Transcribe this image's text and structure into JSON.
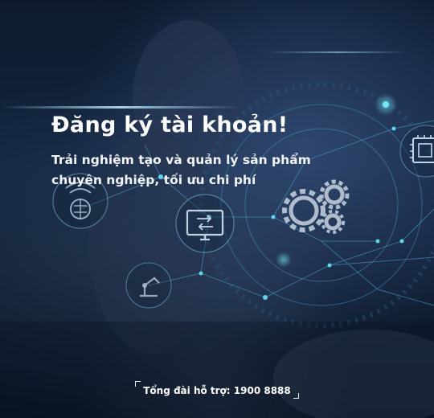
{
  "hero": {
    "title": "Đăng ký tài khoản!",
    "subtitle_line1": "Trải nghiệm tạo và quản lý sản phẩm",
    "subtitle_line2": "chuyên nghiệp, tối ưu chi phí"
  },
  "footer": {
    "hotline": "Tổng đài hỗ trợ: 1900 8888"
  },
  "colors": {
    "background": "#0d1a2e",
    "accent_glow": "#4fd8e8",
    "text": "#ffffff"
  },
  "icons": [
    "brain-wifi-icon",
    "monitor-exchange-icon",
    "robot-arm-icon",
    "gears-icon",
    "cpu-chip-icon"
  ]
}
